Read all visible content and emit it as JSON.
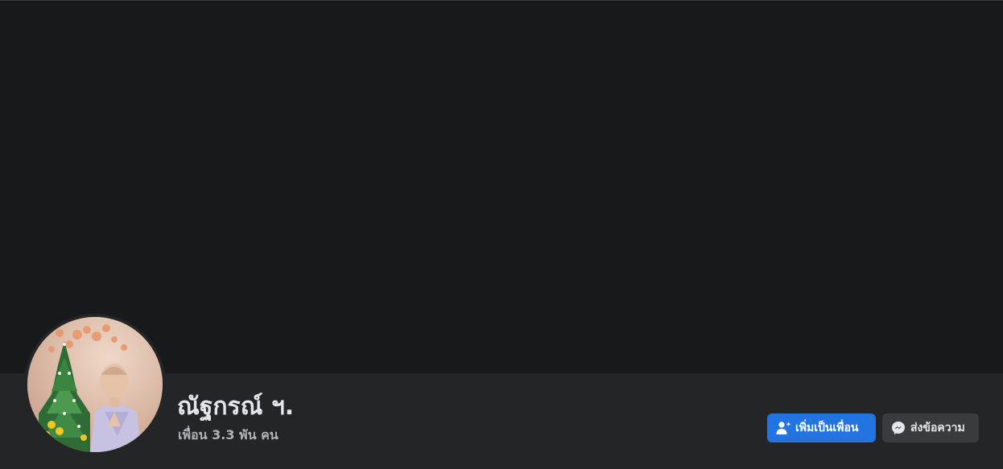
{
  "profile": {
    "name": "ณัฐกรณ์ ฯ.",
    "friends_count": "เพื่อน 3.3 พัน คน"
  },
  "actions": {
    "add_friend_label": "เพิ่มเป็นเพื่อน",
    "message_label": "ส่งข้อความ"
  },
  "icons": {
    "add_friend": "person-plus-icon",
    "message": "messenger-icon"
  },
  "colors": {
    "cover": "#18191a",
    "header_bg": "#242526",
    "primary_button": "#2374e1",
    "secondary_button": "#3a3b3c",
    "text_primary": "#e4e6eb",
    "text_secondary": "#b0b3b8"
  }
}
